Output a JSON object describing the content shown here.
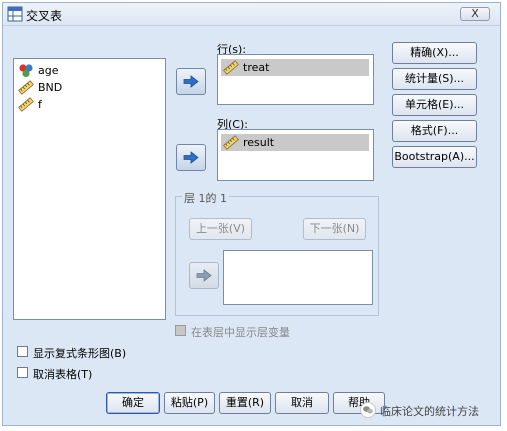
{
  "window": {
    "title": "交叉表",
    "close_label": "X"
  },
  "source_list": {
    "items": [
      {
        "label": "age",
        "icon": "nominal-variable-icon"
      },
      {
        "label": "BND",
        "icon": "scale-variable-icon"
      },
      {
        "label": "f",
        "icon": "scale-variable-icon"
      }
    ]
  },
  "rows": {
    "label": "行(s):",
    "items": [
      {
        "label": "treat",
        "icon": "scale-variable-icon"
      }
    ]
  },
  "columns": {
    "label": "列(C):",
    "items": [
      {
        "label": "result",
        "icon": "scale-variable-icon"
      }
    ]
  },
  "layer": {
    "title": "层 1的 1",
    "previous_label": "上一张(V)",
    "next_label": "下一张(N)",
    "display_layer_variables_label": "在表层中显示层变量",
    "display_layer_variables_checked": false,
    "display_layer_variables_enabled": false
  },
  "side_buttons": [
    {
      "label": "精确(X)..."
    },
    {
      "label": "统计量(S)..."
    },
    {
      "label": "单元格(E)..."
    },
    {
      "label": "格式(F)..."
    },
    {
      "label": "Bootstrap(A)..."
    }
  ],
  "options": {
    "clustered_bar_label": "显示复式条形图(B)",
    "clustered_bar_checked": false,
    "suppress_tables_label": "取消表格(T)",
    "suppress_tables_checked": false
  },
  "bottom_buttons": [
    {
      "label": "确定"
    },
    {
      "label": "粘贴(P)"
    },
    {
      "label": "重置(R)"
    },
    {
      "label": "取消"
    },
    {
      "label": "帮助"
    }
  ],
  "watermark": {
    "text": "临床论文的统计方法"
  },
  "colors": {
    "dialog_bg": "#dce7f5",
    "arrow_blue": "#2f6fc4",
    "selected_item": "#c9c9c9"
  }
}
